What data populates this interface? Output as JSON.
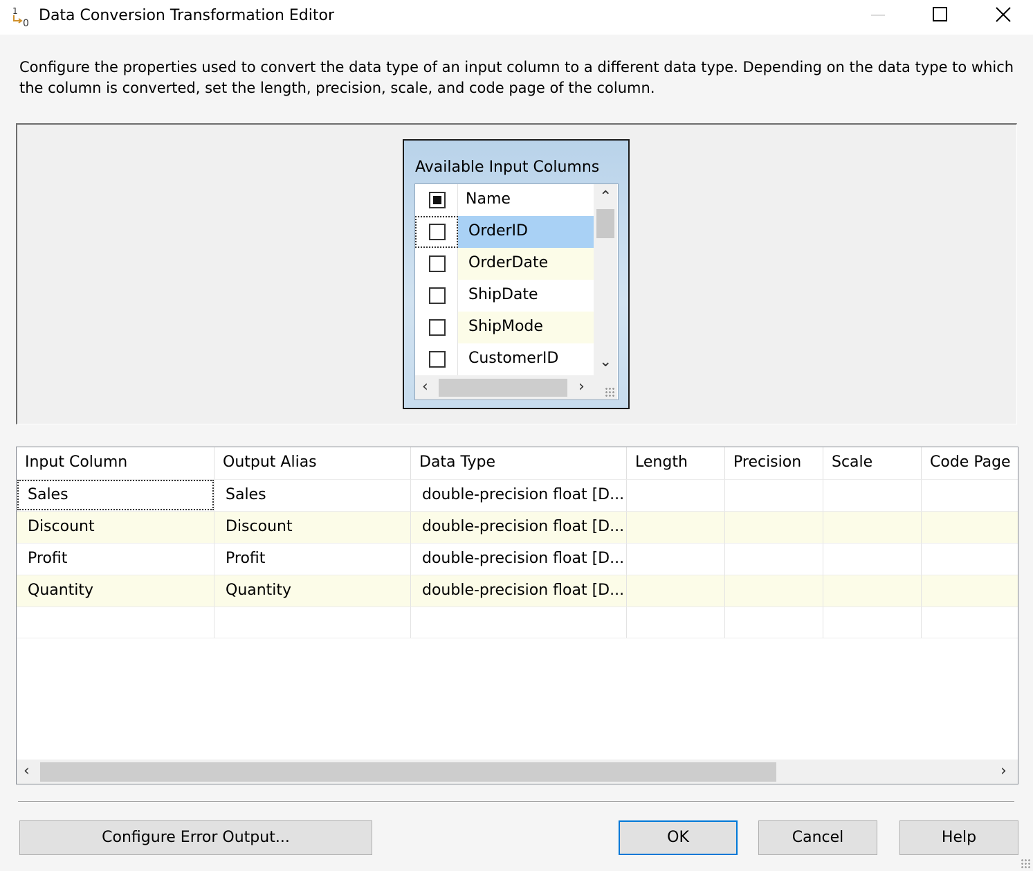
{
  "window": {
    "title": "Data Conversion Transformation Editor",
    "icon": "data-conversion-icon",
    "controls": [
      "minimize-icon",
      "maximize-icon",
      "close-icon"
    ]
  },
  "description": "Configure the properties used to convert the data type of an input column to a different data type. Depending on the data type to which the column is converted, set the length, precision, scale, and code page of the column.",
  "available_columns": {
    "title": "Available Input Columns",
    "header": {
      "select_all_state": "partial",
      "label": "Name"
    },
    "items": [
      {
        "name": "OrderID",
        "checked": false,
        "selected": true
      },
      {
        "name": "OrderDate",
        "checked": false,
        "selected": false
      },
      {
        "name": "ShipDate",
        "checked": false,
        "selected": false
      },
      {
        "name": "ShipMode",
        "checked": false,
        "selected": false
      },
      {
        "name": "CustomerID",
        "checked": false,
        "selected": false
      }
    ]
  },
  "grid": {
    "columns": [
      "Input Column",
      "Output Alias",
      "Data Type",
      "Length",
      "Precision",
      "Scale",
      "Code Page"
    ],
    "rows": [
      [
        "Sales",
        "Sales",
        "double-precision float [D...",
        "",
        "",
        "",
        ""
      ],
      [
        "Discount",
        "Discount",
        "double-precision float [D...",
        "",
        "",
        "",
        ""
      ],
      [
        "Profit",
        "Profit",
        "double-precision float [D...",
        "",
        "",
        "",
        ""
      ],
      [
        "Quantity",
        "Quantity",
        "double-precision float [D...",
        "",
        "",
        "",
        ""
      ],
      [
        "",
        "",
        "",
        "",
        "",
        "",
        ""
      ]
    ]
  },
  "buttons": {
    "configure_error_output": "Configure Error Output...",
    "ok": "OK",
    "cancel": "Cancel",
    "help": "Help"
  },
  "colors": {
    "selection": "#a9d1f5",
    "alt_row": "#fcfce8",
    "default_button_border": "#0078d7"
  }
}
